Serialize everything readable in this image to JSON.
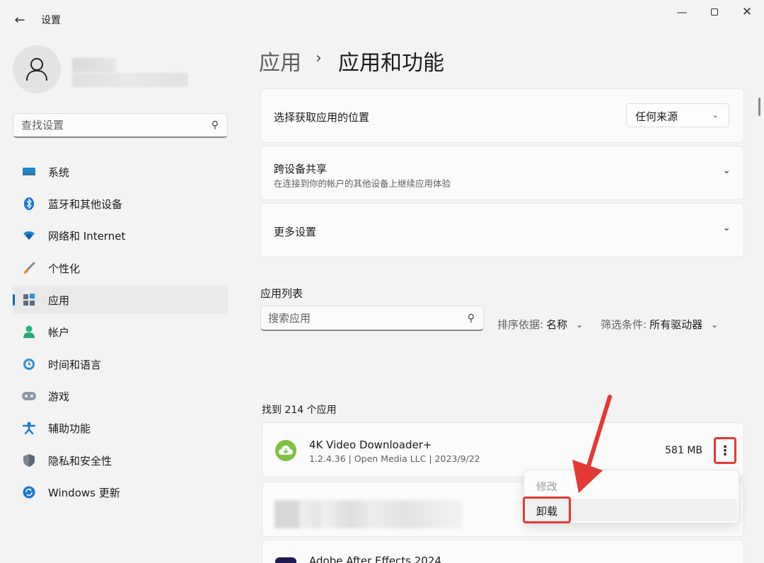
{
  "window": {
    "title": "设置",
    "controls": [
      "minimize",
      "maximize",
      "close"
    ]
  },
  "sidebar": {
    "search_placeholder": "查找设置",
    "items": [
      {
        "label": "系统",
        "icon": "monitor-icon",
        "active": false
      },
      {
        "label": "蓝牙和其他设备",
        "icon": "bluetooth-icon",
        "active": false
      },
      {
        "label": "网络和 Internet",
        "icon": "wifi-icon",
        "active": false
      },
      {
        "label": "个性化",
        "icon": "brush-icon",
        "active": false
      },
      {
        "label": "应用",
        "icon": "apps-icon",
        "active": true
      },
      {
        "label": "帐户",
        "icon": "account-icon",
        "active": false
      },
      {
        "label": "时间和语言",
        "icon": "clock-globe-icon",
        "active": false
      },
      {
        "label": "游戏",
        "icon": "gamepad-icon",
        "active": false
      },
      {
        "label": "辅助功能",
        "icon": "accessibility-icon",
        "active": false
      },
      {
        "label": "隐私和安全性",
        "icon": "shield-icon",
        "active": false
      },
      {
        "label": "Windows 更新",
        "icon": "refresh-icon",
        "active": false
      }
    ]
  },
  "breadcrumb": {
    "parent": "应用",
    "current": "应用和功能"
  },
  "settings": {
    "source": {
      "label": "选择获取应用的位置",
      "value": "任何来源"
    },
    "share": {
      "label": "跨设备共享",
      "description": "在连接到你的帐户的其他设备上继续应用体验"
    },
    "more": {
      "label": "更多设置"
    }
  },
  "app_list": {
    "heading": "应用列表",
    "search_placeholder": "搜索应用",
    "sort_label": "排序依据:",
    "sort_value": "名称",
    "filter_label": "筛选条件:",
    "filter_value": "所有驱动器",
    "found_text": "找到 214 个应用",
    "apps": [
      {
        "name": "4K Video Downloader+",
        "meta": "1.2.4.36  |  Open Media LLC  |  2023/9/22",
        "size": "581 MB"
      },
      {
        "name": "Adobe After Effects 2024"
      }
    ]
  },
  "context_menu": {
    "items": [
      {
        "label": "修改",
        "disabled": true
      },
      {
        "label": "卸载",
        "disabled": false
      }
    ]
  },
  "colors": {
    "accent": "#0067c0",
    "highlight": "#e53935",
    "background": "#f3f3f3",
    "card": "#fbfbfb"
  }
}
